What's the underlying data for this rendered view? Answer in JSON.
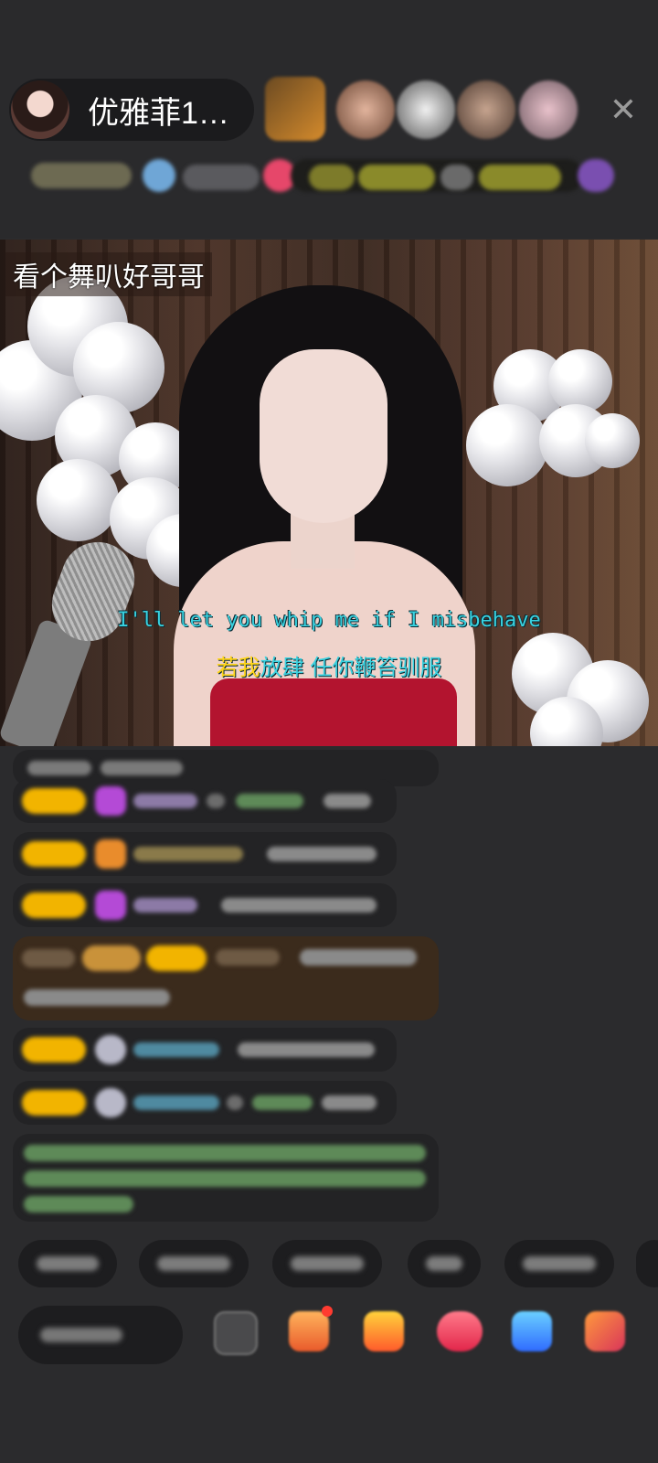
{
  "header": {
    "host_name": "优雅菲1…",
    "close_symbol": "✕",
    "viewer_avatars": [
      {
        "color": "#b98c3a"
      },
      {
        "color": "#c89a86"
      },
      {
        "color": "#d8d8d8"
      },
      {
        "color": "#a0826e"
      },
      {
        "color": "#caa3ad"
      }
    ]
  },
  "video": {
    "caption": "看个舞叭好哥哥",
    "lyric_en": "I'll let you whip me if I misbehave",
    "lyric_zh_highlight": "若我",
    "lyric_zh_rest": "放肆 任你鞭笞驯服"
  },
  "colors": {
    "badge_gold": "#f2b400",
    "lyric_cyan": "#39d2e0",
    "lyric_yellow": "#ffd51a",
    "gem_purple": "#b44ad6",
    "gift_orange": "#e98c2c",
    "chat_green": "#7bc96a"
  }
}
